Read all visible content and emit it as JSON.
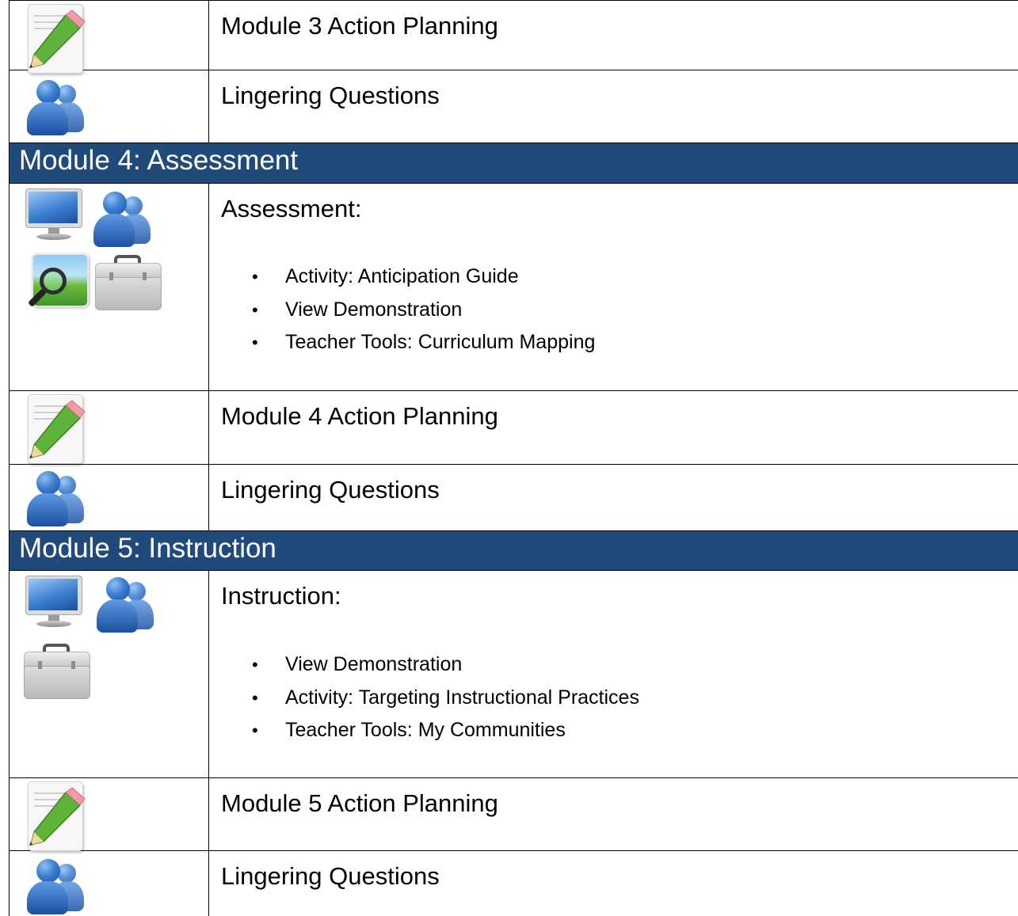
{
  "rows": [
    {
      "title": "Module 3 Action Planning",
      "icons": [
        "pencil-icon"
      ]
    },
    {
      "title": "Lingering Questions",
      "icons": [
        "people-icon"
      ]
    },
    {
      "header": "Module 4: Assessment"
    },
    {
      "title": "Assessment:",
      "icons": [
        "monitor-icon",
        "people-icon",
        "magnifier-icon",
        "toolbox-icon"
      ],
      "bullets": [
        "Activity: Anticipation Guide",
        "View Demonstration",
        "Teacher Tools: Curriculum Mapping"
      ]
    },
    {
      "title": "Module 4 Action Planning",
      "icons": [
        "pencil-icon"
      ]
    },
    {
      "title": "Lingering Questions",
      "icons": [
        "people-icon"
      ]
    },
    {
      "header": "Module 5: Instruction"
    },
    {
      "title": "Instruction:",
      "icons": [
        "monitor-icon",
        "people-icon",
        "toolbox-icon"
      ],
      "bullets": [
        "View Demonstration",
        "Activity: Targeting Instructional Practices",
        "Teacher Tools: My Communities"
      ]
    },
    {
      "title": "Module 5 Action Planning",
      "icons": [
        "pencil-icon"
      ]
    },
    {
      "title": "Lingering Questions",
      "icons": [
        "people-icon"
      ]
    }
  ],
  "bullet_glyph": "•",
  "colors": {
    "header_bg": "#1f4a7a",
    "header_text": "#ffffff"
  }
}
